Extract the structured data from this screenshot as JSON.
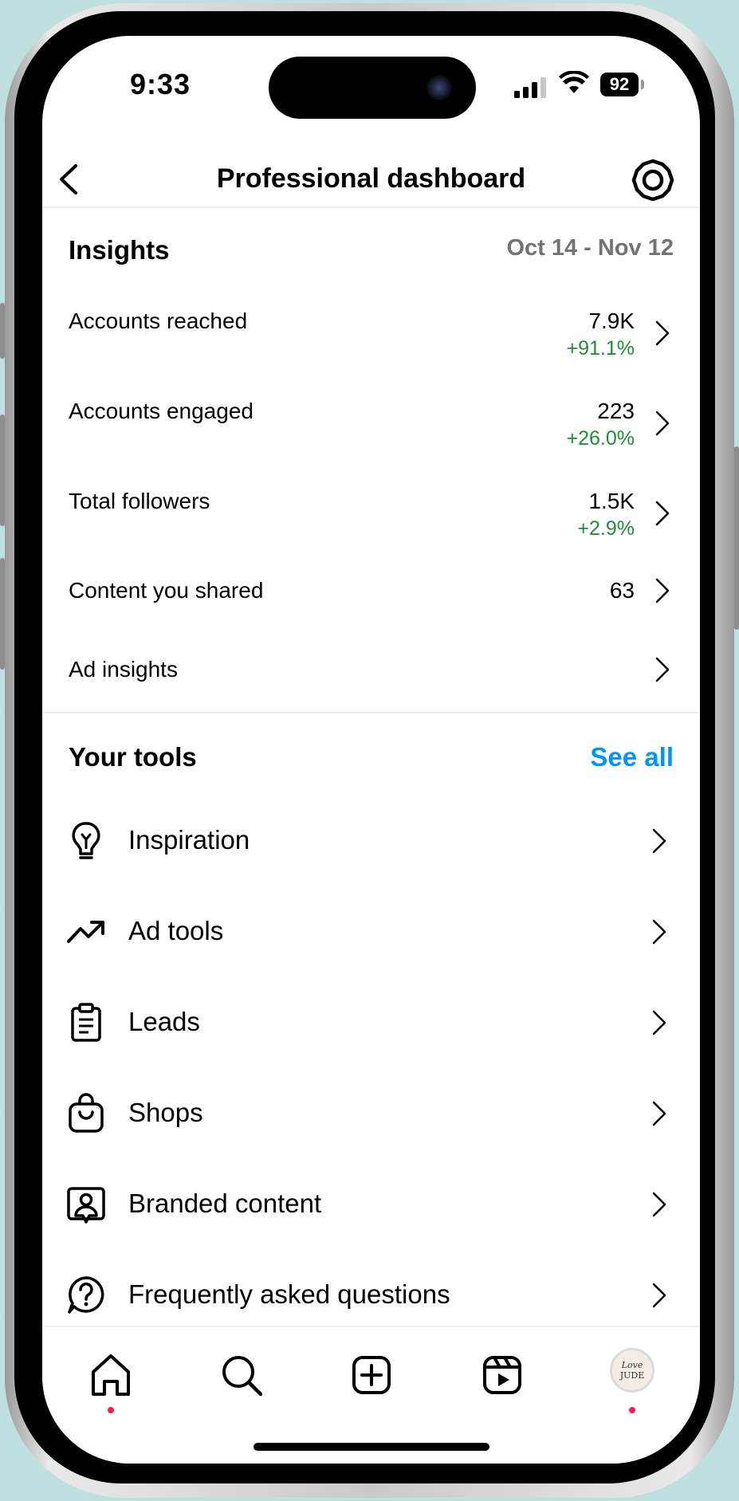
{
  "status_bar": {
    "time": "9:33",
    "battery": "92",
    "icons": [
      "signal-icon",
      "wifi-icon",
      "battery-icon"
    ]
  },
  "header": {
    "title": "Professional dashboard",
    "back_icon": "chevron-left-icon",
    "settings_icon": "gear-icon"
  },
  "insights": {
    "title": "Insights",
    "date_range": "Oct 14 - Nov 12",
    "rows": [
      {
        "label": "Accounts reached",
        "value": "7.9K",
        "change": "+91.1%"
      },
      {
        "label": "Accounts engaged",
        "value": "223",
        "change": "+26.0%"
      },
      {
        "label": "Total followers",
        "value": "1.5K",
        "change": "+2.9%"
      },
      {
        "label": "Content you shared",
        "value": "63",
        "change": ""
      },
      {
        "label": "Ad insights",
        "value": "",
        "change": ""
      }
    ]
  },
  "tools": {
    "title": "Your tools",
    "see_all": "See all",
    "items": [
      {
        "label": "Inspiration",
        "icon": "lightbulb-icon"
      },
      {
        "label": "Ad tools",
        "icon": "trending-up-icon"
      },
      {
        "label": "Leads",
        "icon": "clipboard-icon"
      },
      {
        "label": "Shops",
        "icon": "shopping-bag-icon"
      },
      {
        "label": "Branded content",
        "icon": "branded-content-icon"
      },
      {
        "label": "Frequently asked questions",
        "icon": "question-icon"
      }
    ]
  },
  "tabbar": {
    "tabs": [
      "home-icon",
      "search-icon",
      "create-icon",
      "reels-icon",
      "profile-avatar"
    ],
    "avatar_text_line1": "Love",
    "avatar_text_line2": "JUDE"
  },
  "colors": {
    "accent": "#0095f6",
    "positive": "#1d8f37",
    "muted": "#737373",
    "notification_dot": "#ff1a4b"
  }
}
